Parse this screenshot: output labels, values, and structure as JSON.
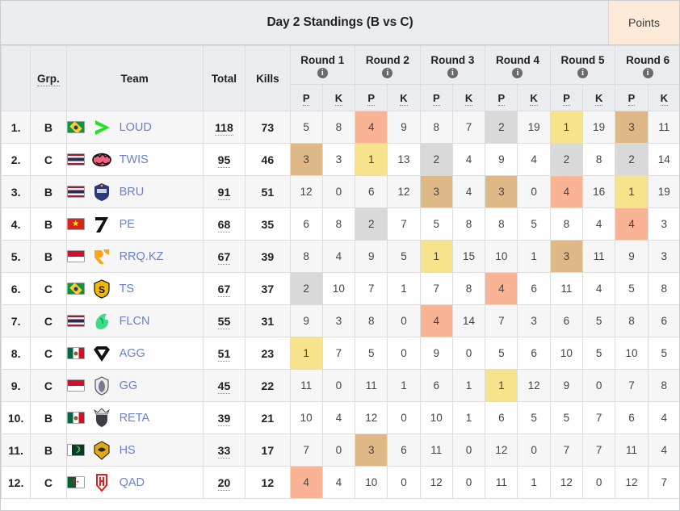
{
  "header": {
    "title": "Day 2 Standings (B vs C)",
    "points_toggle_label": "Points"
  },
  "columns": {
    "rank": "",
    "group": "Grp.",
    "team": "Team",
    "total": "Total",
    "kills": "Kills",
    "placement_short": "P",
    "kills_short": "K",
    "info_glyph": "i",
    "rounds": [
      "Round 1",
      "Round 2",
      "Round 3",
      "Round 4",
      "Round 5",
      "Round 6"
    ]
  },
  "colors": {
    "place_1": "#f8e38d",
    "place_2": "#d9d9d9",
    "place_3": "#deb887",
    "place_4": "#f9b495",
    "header_bg": "#eaecf0",
    "points_toggle_bg": "#fdead9",
    "team_link": "#6b7fd0"
  },
  "chart_data": {
    "type": "table",
    "title": "Day 2 Standings (B vs C)",
    "columns": [
      "#",
      "Grp.",
      "Team",
      "Total",
      "Kills",
      "R1 P",
      "R1 K",
      "R2 P",
      "R2 K",
      "R3 P",
      "R3 K",
      "R4 P",
      "R4 K",
      "R5 P",
      "R5 K",
      "R6 P",
      "R6 K"
    ],
    "rows": [
      [
        "1.",
        "B",
        "LOUD",
        118,
        73,
        5,
        8,
        4,
        9,
        8,
        7,
        2,
        19,
        1,
        19,
        3,
        11
      ],
      [
        "2.",
        "C",
        "TWIS",
        95,
        46,
        3,
        3,
        1,
        13,
        2,
        4,
        9,
        4,
        2,
        8,
        2,
        14
      ],
      [
        "3.",
        "B",
        "BRU",
        91,
        51,
        12,
        0,
        6,
        12,
        3,
        4,
        3,
        0,
        4,
        16,
        1,
        19
      ],
      [
        "4.",
        "B",
        "PE",
        68,
        35,
        6,
        8,
        2,
        7,
        5,
        8,
        8,
        5,
        8,
        4,
        4,
        3
      ],
      [
        "5.",
        "B",
        "RRQ.KZ",
        67,
        39,
        8,
        4,
        9,
        5,
        1,
        15,
        10,
        1,
        3,
        11,
        9,
        3
      ],
      [
        "6.",
        "C",
        "TS",
        67,
        37,
        2,
        10,
        7,
        1,
        7,
        8,
        4,
        6,
        11,
        4,
        5,
        8
      ],
      [
        "7.",
        "C",
        "FLCN",
        55,
        31,
        9,
        3,
        8,
        0,
        4,
        14,
        7,
        3,
        6,
        5,
        8,
        6
      ],
      [
        "8.",
        "C",
        "AGG",
        51,
        23,
        1,
        7,
        5,
        0,
        9,
        0,
        5,
        6,
        10,
        5,
        10,
        5
      ],
      [
        "9.",
        "C",
        "GG",
        45,
        22,
        11,
        0,
        11,
        1,
        6,
        1,
        1,
        12,
        9,
        0,
        7,
        8
      ],
      [
        "10.",
        "B",
        "RETA",
        39,
        21,
        10,
        4,
        12,
        0,
        10,
        1,
        6,
        5,
        5,
        7,
        6,
        4
      ],
      [
        "11.",
        "B",
        "HS",
        33,
        17,
        7,
        0,
        3,
        6,
        11,
        0,
        12,
        0,
        7,
        7,
        11,
        4
      ],
      [
        "12.",
        "C",
        "QAD",
        20,
        12,
        4,
        4,
        10,
        0,
        12,
        0,
        11,
        1,
        12,
        0,
        12,
        7
      ]
    ]
  },
  "rows": [
    {
      "rank": "1.",
      "group": "B",
      "team": "LOUD",
      "total": "118",
      "kills": "73",
      "flag": "flag-br",
      "flag_name": "flag-brazil",
      "logo": "loud-logo",
      "r": [
        {
          "p": "5",
          "k": "8",
          "hl": ""
        },
        {
          "p": "4",
          "k": "9",
          "hl": "hl-4"
        },
        {
          "p": "8",
          "k": "7",
          "hl": ""
        },
        {
          "p": "2",
          "k": "19",
          "hl": "hl-2"
        },
        {
          "p": "1",
          "k": "19",
          "hl": "hl-1"
        },
        {
          "p": "3",
          "k": "11",
          "hl": "hl-3"
        }
      ]
    },
    {
      "rank": "2.",
      "group": "C",
      "team": "TWIS",
      "total": "95",
      "kills": "46",
      "flag": "flag-th",
      "flag_name": "flag-thailand",
      "logo": "twis-logo",
      "r": [
        {
          "p": "3",
          "k": "3",
          "hl": "hl-3"
        },
        {
          "p": "1",
          "k": "13",
          "hl": "hl-1"
        },
        {
          "p": "2",
          "k": "4",
          "hl": "hl-2"
        },
        {
          "p": "9",
          "k": "4",
          "hl": ""
        },
        {
          "p": "2",
          "k": "8",
          "hl": "hl-2"
        },
        {
          "p": "2",
          "k": "14",
          "hl": "hl-2"
        }
      ]
    },
    {
      "rank": "3.",
      "group": "B",
      "team": "BRU",
      "total": "91",
      "kills": "51",
      "flag": "flag-th",
      "flag_name": "flag-thailand",
      "logo": "bru-logo",
      "r": [
        {
          "p": "12",
          "k": "0",
          "hl": ""
        },
        {
          "p": "6",
          "k": "12",
          "hl": ""
        },
        {
          "p": "3",
          "k": "4",
          "hl": "hl-3"
        },
        {
          "p": "3",
          "k": "0",
          "hl": "hl-3"
        },
        {
          "p": "4",
          "k": "16",
          "hl": "hl-4"
        },
        {
          "p": "1",
          "k": "19",
          "hl": "hl-1"
        }
      ]
    },
    {
      "rank": "4.",
      "group": "B",
      "team": "PE",
      "total": "68",
      "kills": "35",
      "flag": "flag-vn",
      "flag_name": "flag-vietnam",
      "logo": "pe-logo",
      "r": [
        {
          "p": "6",
          "k": "8",
          "hl": ""
        },
        {
          "p": "2",
          "k": "7",
          "hl": "hl-2"
        },
        {
          "p": "5",
          "k": "8",
          "hl": ""
        },
        {
          "p": "8",
          "k": "5",
          "hl": ""
        },
        {
          "p": "8",
          "k": "4",
          "hl": ""
        },
        {
          "p": "4",
          "k": "3",
          "hl": "hl-4"
        }
      ]
    },
    {
      "rank": "5.",
      "group": "B",
      "team": "RRQ.KZ",
      "total": "67",
      "kills": "39",
      "flag": "flag-id",
      "flag_name": "flag-indonesia",
      "logo": "rrq-logo",
      "r": [
        {
          "p": "8",
          "k": "4",
          "hl": ""
        },
        {
          "p": "9",
          "k": "5",
          "hl": ""
        },
        {
          "p": "1",
          "k": "15",
          "hl": "hl-1"
        },
        {
          "p": "10",
          "k": "1",
          "hl": ""
        },
        {
          "p": "3",
          "k": "11",
          "hl": "hl-3"
        },
        {
          "p": "9",
          "k": "3",
          "hl": ""
        }
      ]
    },
    {
      "rank": "6.",
      "group": "C",
      "team": "TS",
      "total": "67",
      "kills": "37",
      "flag": "flag-br",
      "flag_name": "flag-brazil",
      "logo": "ts-logo",
      "r": [
        {
          "p": "2",
          "k": "10",
          "hl": "hl-2"
        },
        {
          "p": "7",
          "k": "1",
          "hl": ""
        },
        {
          "p": "7",
          "k": "8",
          "hl": ""
        },
        {
          "p": "4",
          "k": "6",
          "hl": "hl-4"
        },
        {
          "p": "11",
          "k": "4",
          "hl": ""
        },
        {
          "p": "5",
          "k": "8",
          "hl": ""
        }
      ]
    },
    {
      "rank": "7.",
      "group": "C",
      "team": "FLCN",
      "total": "55",
      "kills": "31",
      "flag": "flag-th",
      "flag_name": "flag-thailand",
      "logo": "flcn-logo",
      "r": [
        {
          "p": "9",
          "k": "3",
          "hl": ""
        },
        {
          "p": "8",
          "k": "0",
          "hl": ""
        },
        {
          "p": "4",
          "k": "14",
          "hl": "hl-4"
        },
        {
          "p": "7",
          "k": "3",
          "hl": ""
        },
        {
          "p": "6",
          "k": "5",
          "hl": ""
        },
        {
          "p": "8",
          "k": "6",
          "hl": ""
        }
      ]
    },
    {
      "rank": "8.",
      "group": "C",
      "team": "AGG",
      "total": "51",
      "kills": "23",
      "flag": "flag-mx",
      "flag_name": "flag-mexico",
      "logo": "agg-logo",
      "r": [
        {
          "p": "1",
          "k": "7",
          "hl": "hl-1"
        },
        {
          "p": "5",
          "k": "0",
          "hl": ""
        },
        {
          "p": "9",
          "k": "0",
          "hl": ""
        },
        {
          "p": "5",
          "k": "6",
          "hl": ""
        },
        {
          "p": "10",
          "k": "5",
          "hl": ""
        },
        {
          "p": "10",
          "k": "5",
          "hl": ""
        }
      ]
    },
    {
      "rank": "9.",
      "group": "C",
      "team": "GG",
      "total": "45",
      "kills": "22",
      "flag": "flag-id",
      "flag_name": "flag-indonesia",
      "logo": "gg-logo",
      "r": [
        {
          "p": "11",
          "k": "0",
          "hl": ""
        },
        {
          "p": "11",
          "k": "1",
          "hl": ""
        },
        {
          "p": "6",
          "k": "1",
          "hl": ""
        },
        {
          "p": "1",
          "k": "12",
          "hl": "hl-1"
        },
        {
          "p": "9",
          "k": "0",
          "hl": ""
        },
        {
          "p": "7",
          "k": "8",
          "hl": ""
        }
      ]
    },
    {
      "rank": "10.",
      "group": "B",
      "team": "RETA",
      "total": "39",
      "kills": "21",
      "flag": "flag-mx",
      "flag_name": "flag-mexico",
      "logo": "reta-logo",
      "r": [
        {
          "p": "10",
          "k": "4",
          "hl": ""
        },
        {
          "p": "12",
          "k": "0",
          "hl": ""
        },
        {
          "p": "10",
          "k": "1",
          "hl": ""
        },
        {
          "p": "6",
          "k": "5",
          "hl": ""
        },
        {
          "p": "5",
          "k": "7",
          "hl": ""
        },
        {
          "p": "6",
          "k": "4",
          "hl": ""
        }
      ]
    },
    {
      "rank": "11.",
      "group": "B",
      "team": "HS",
      "total": "33",
      "kills": "17",
      "flag": "flag-pk",
      "flag_name": "flag-pakistan",
      "logo": "hs-logo",
      "r": [
        {
          "p": "7",
          "k": "0",
          "hl": ""
        },
        {
          "p": "3",
          "k": "6",
          "hl": "hl-3"
        },
        {
          "p": "11",
          "k": "0",
          "hl": ""
        },
        {
          "p": "12",
          "k": "0",
          "hl": ""
        },
        {
          "p": "7",
          "k": "7",
          "hl": ""
        },
        {
          "p": "11",
          "k": "4",
          "hl": ""
        }
      ]
    },
    {
      "rank": "12.",
      "group": "C",
      "team": "QAD",
      "total": "20",
      "kills": "12",
      "flag": "flag-dz",
      "flag_name": "flag-algeria",
      "logo": "qad-logo",
      "r": [
        {
          "p": "4",
          "k": "4",
          "hl": "hl-4"
        },
        {
          "p": "10",
          "k": "0",
          "hl": ""
        },
        {
          "p": "12",
          "k": "0",
          "hl": ""
        },
        {
          "p": "11",
          "k": "1",
          "hl": ""
        },
        {
          "p": "12",
          "k": "0",
          "hl": ""
        },
        {
          "p": "12",
          "k": "7",
          "hl": ""
        }
      ]
    }
  ]
}
